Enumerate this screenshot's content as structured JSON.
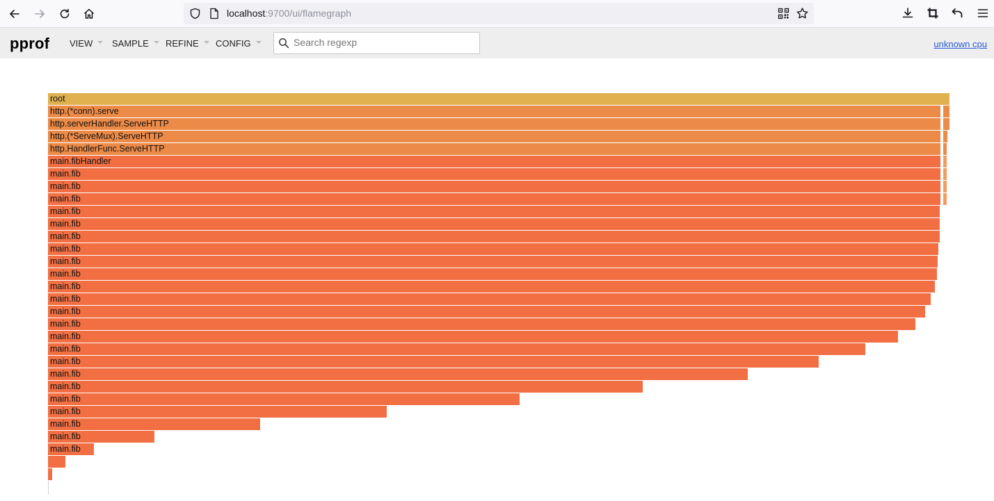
{
  "browser": {
    "url_host": "localhost",
    "url_rest": ":9700/ui/flamegraph"
  },
  "header": {
    "logo": "pprof",
    "menus": [
      {
        "label": "VIEW"
      },
      {
        "label": "SAMPLE"
      },
      {
        "label": "REFINE"
      },
      {
        "label": "CONFIG"
      }
    ],
    "search_placeholder": "Search regexp",
    "profile_link": "unknown cpu"
  },
  "colors": {
    "root": "#e0b24f",
    "http": "#ec8b47",
    "main": "#f16f43",
    "main_light": "#f49b63"
  },
  "flamegraph": {
    "total": 1000,
    "frames": [
      {
        "label": "root",
        "depth": 0,
        "start": 0,
        "value": 1000,
        "kind": "root"
      },
      {
        "label": "http.(*conn).serve",
        "depth": 1,
        "start": 0,
        "value": 990,
        "kind": "http"
      },
      {
        "label": "",
        "depth": 1,
        "start": 993,
        "value": 7,
        "kind": "http"
      },
      {
        "label": "http.serverHandler.ServeHTTP",
        "depth": 2,
        "start": 0,
        "value": 990,
        "kind": "http"
      },
      {
        "label": "",
        "depth": 2,
        "start": 993,
        "value": 7,
        "kind": "http"
      },
      {
        "label": "http.(*ServeMux).ServeHTTP",
        "depth": 3,
        "start": 0,
        "value": 990,
        "kind": "http"
      },
      {
        "label": "",
        "depth": 3,
        "start": 993,
        "value": 5,
        "kind": "http"
      },
      {
        "label": "http.HandlerFunc.ServeHTTP",
        "depth": 4,
        "start": 0,
        "value": 990,
        "kind": "http"
      },
      {
        "label": "",
        "depth": 4,
        "start": 993,
        "value": 4,
        "kind": "http"
      },
      {
        "label": "main.fibHandler",
        "depth": 5,
        "start": 0,
        "value": 990,
        "kind": "main"
      },
      {
        "label": "",
        "depth": 5,
        "start": 993,
        "value": 4,
        "kind": "main_light"
      },
      {
        "label": "main.fib",
        "depth": 6,
        "start": 0,
        "value": 990,
        "kind": "main"
      },
      {
        "label": "",
        "depth": 6,
        "start": 993,
        "value": 4,
        "kind": "main_light"
      },
      {
        "label": "main.fib",
        "depth": 7,
        "start": 0,
        "value": 990,
        "kind": "main"
      },
      {
        "label": "",
        "depth": 7,
        "start": 993,
        "value": 4,
        "kind": "main_light"
      },
      {
        "label": "main.fib",
        "depth": 8,
        "start": 0,
        "value": 990,
        "kind": "main"
      },
      {
        "label": "",
        "depth": 8,
        "start": 993,
        "value": 4,
        "kind": "main_light"
      },
      {
        "label": "main.fib",
        "depth": 9,
        "start": 0,
        "value": 989,
        "kind": "main"
      },
      {
        "label": "main.fib",
        "depth": 10,
        "start": 0,
        "value": 989,
        "kind": "main"
      },
      {
        "label": "main.fib",
        "depth": 11,
        "start": 0,
        "value": 989,
        "kind": "main"
      },
      {
        "label": "main.fib",
        "depth": 12,
        "start": 0,
        "value": 988,
        "kind": "main"
      },
      {
        "label": "main.fib",
        "depth": 13,
        "start": 0,
        "value": 987,
        "kind": "main"
      },
      {
        "label": "main.fib",
        "depth": 14,
        "start": 0,
        "value": 986,
        "kind": "main"
      },
      {
        "label": "main.fib",
        "depth": 15,
        "start": 0,
        "value": 984,
        "kind": "main"
      },
      {
        "label": "main.fib",
        "depth": 16,
        "start": 0,
        "value": 979,
        "kind": "main"
      },
      {
        "label": "main.fib",
        "depth": 17,
        "start": 0,
        "value": 973,
        "kind": "main"
      },
      {
        "label": "main.fib",
        "depth": 18,
        "start": 0,
        "value": 962,
        "kind": "main"
      },
      {
        "label": "main.fib",
        "depth": 19,
        "start": 0,
        "value": 943,
        "kind": "main"
      },
      {
        "label": "main.fib",
        "depth": 20,
        "start": 0,
        "value": 907,
        "kind": "main"
      },
      {
        "label": "main.fib",
        "depth": 21,
        "start": 0,
        "value": 855,
        "kind": "main"
      },
      {
        "label": "main.fib",
        "depth": 22,
        "start": 0,
        "value": 776,
        "kind": "main"
      },
      {
        "label": "main.fib",
        "depth": 23,
        "start": 0,
        "value": 660,
        "kind": "main"
      },
      {
        "label": "main.fib",
        "depth": 24,
        "start": 0,
        "value": 523,
        "kind": "main"
      },
      {
        "label": "main.fib",
        "depth": 25,
        "start": 0,
        "value": 376,
        "kind": "main"
      },
      {
        "label": "main.fib",
        "depth": 26,
        "start": 0,
        "value": 235,
        "kind": "main"
      },
      {
        "label": "main.fib",
        "depth": 27,
        "start": 0,
        "value": 118,
        "kind": "main"
      },
      {
        "label": "main.fib",
        "depth": 28,
        "start": 0,
        "value": 51,
        "kind": "main"
      },
      {
        "label": "",
        "depth": 29,
        "start": 0,
        "value": 19,
        "kind": "main"
      },
      {
        "label": "",
        "depth": 30,
        "start": 0,
        "value": 5,
        "kind": "main"
      }
    ]
  }
}
